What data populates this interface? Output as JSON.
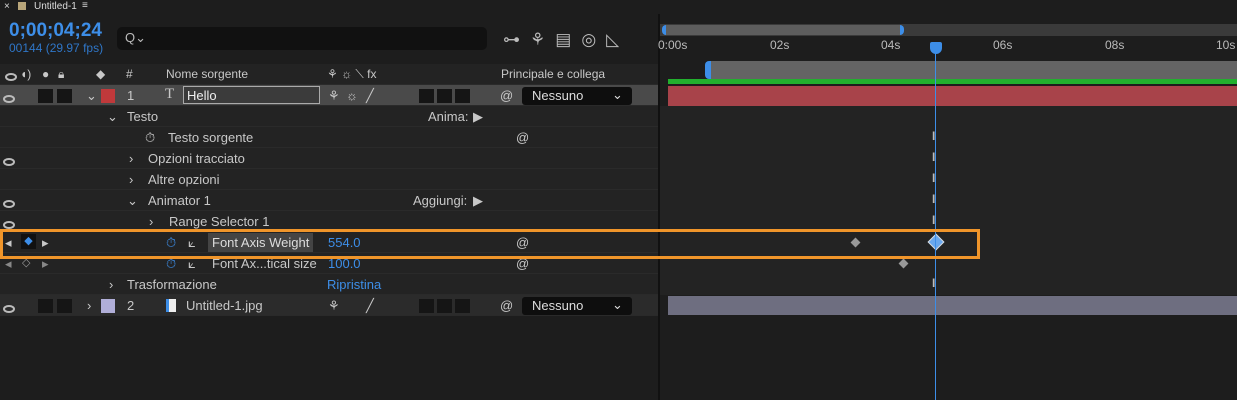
{
  "tab": {
    "close": "×",
    "title": "Untitled-1",
    "menu": "≡"
  },
  "timecode": "0;00;04;24",
  "frames": "00144 (29.97 fps)",
  "search": {
    "icon": "search-icon",
    "glyph": "Q⌄"
  },
  "header": {
    "num": "#",
    "source_name": "Nome sorgente",
    "switches": "⚘ ☼ ⟍ fx",
    "parent": "Principale e collega"
  },
  "layers": [
    {
      "num": "1",
      "type_glyph": "T",
      "name": "Hello",
      "parent": "Nessuno",
      "label_color": "#c0393b"
    },
    {
      "num": "2",
      "name": "Untitled-1.jpg",
      "parent": "Nessuno",
      "label_color": "#b0aed8"
    }
  ],
  "props": {
    "testo": "Testo",
    "anima": "Anima:",
    "testo_sorgente": "Testo sorgente",
    "opzioni": "Opzioni tracciato",
    "altre": "Altre opzioni",
    "animator": "Animator 1",
    "aggiungi": "Aggiungi:",
    "range": "Range Selector 1",
    "faw": "Font Axis Weight",
    "faw_value": "554.0",
    "fas": "Font Ax...tical size",
    "fas_value": "100.0",
    "trasf": "Trasformazione",
    "ripristina": "Ripristina"
  },
  "ruler": {
    "ticks": [
      "0:00s",
      "02s",
      "04s",
      "06s",
      "08s",
      "10s"
    ]
  },
  "colors": {
    "accent": "#3d8ee8",
    "highlight": "#f0952a",
    "layer1_bar": "#a8434a",
    "layer2_bar": "#6e6e80",
    "work_area": "#22b02e"
  }
}
